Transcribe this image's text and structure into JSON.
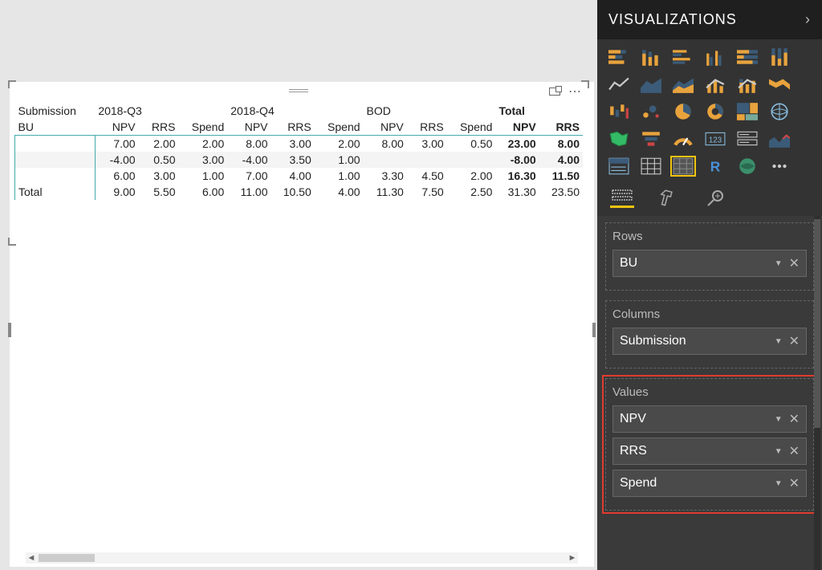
{
  "panel": {
    "title": "VISUALIZATIONS",
    "tabs": [
      "Fields",
      "Format",
      "Analytics"
    ],
    "viz_icons": [
      "stacked-bar",
      "stacked-column",
      "clustered-bar",
      "clustered-column",
      "stacked-bar-100",
      "stacked-column-100",
      "line",
      "area",
      "stacked-area",
      "line-clustered",
      "line-stacked",
      "ribbon",
      "waterfall",
      "scatter",
      "pie",
      "donut",
      "treemap",
      "map",
      "filled-map",
      "funnel",
      "gauge",
      "card",
      "multi-card",
      "kpi",
      "slicer",
      "table",
      "matrix",
      "r-visual",
      "arc-map",
      "more"
    ],
    "selected_viz": "matrix",
    "wells": {
      "rows_label": "Rows",
      "columns_label": "Columns",
      "values_label": "Values",
      "rows": [
        "BU"
      ],
      "columns": [
        "Submission"
      ],
      "values": [
        "NPV",
        "RRS",
        "Spend"
      ]
    }
  },
  "matrix": {
    "row_field": "Submission",
    "row_sub": "BU",
    "column_groups": [
      "2018-Q3",
      "2018-Q4",
      "BOD",
      "Total"
    ],
    "measures": [
      "NPV",
      "RRS",
      "Spend"
    ],
    "total_measures_shown": [
      "NPV",
      "RRS"
    ],
    "rows": [
      {
        "label": "",
        "cells": [
          "7.00",
          "2.00",
          "2.00",
          "8.00",
          "3.00",
          "2.00",
          "8.00",
          "3.00",
          "0.50",
          "23.00",
          "8.00"
        ]
      },
      {
        "label": "",
        "cells": [
          "-4.00",
          "0.50",
          "3.00",
          "-4.00",
          "3.50",
          "1.00",
          "",
          "",
          "",
          "-8.00",
          "4.00"
        ]
      },
      {
        "label": "",
        "cells": [
          "6.00",
          "3.00",
          "1.00",
          "7.00",
          "4.00",
          "1.00",
          "3.30",
          "4.50",
          "2.00",
          "16.30",
          "11.50"
        ]
      }
    ],
    "total_label": "Total",
    "totals": [
      "9.00",
      "5.50",
      "6.00",
      "11.00",
      "10.50",
      "4.00",
      "11.30",
      "7.50",
      "2.50",
      "31.30",
      "23.50"
    ]
  }
}
